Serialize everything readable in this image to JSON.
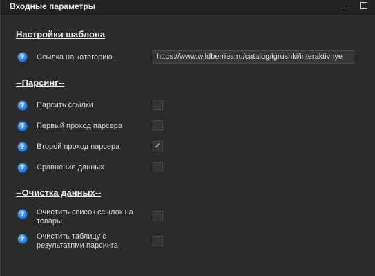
{
  "window": {
    "title": "Входные параметры"
  },
  "template_settings": {
    "heading": "Настройки шаблона",
    "category_link": {
      "label": "Ссылка на категорию",
      "value": "https://www.wildberries.ru/catalog/igrushki/interaktivnye"
    }
  },
  "parsing": {
    "heading": "--Парсинг--",
    "options": [
      {
        "label": "Парсить ссылки",
        "checked": false
      },
      {
        "label": "Первый проход парсера",
        "checked": false
      },
      {
        "label": "Второй проход парсера",
        "checked": true
      },
      {
        "label": "Сравнение данных",
        "checked": false
      }
    ]
  },
  "cleanup": {
    "heading": "--Очистка данных--",
    "options": [
      {
        "label": "Очистить список ссылок на товары",
        "checked": false
      },
      {
        "label": "Очистить таблицу с результатпми парсинга",
        "checked": false
      }
    ]
  },
  "icons": {
    "help": "help-icon",
    "check": "✓"
  },
  "colors": {
    "background": "#2b2b2b",
    "help_icon": "#2f86e6"
  }
}
